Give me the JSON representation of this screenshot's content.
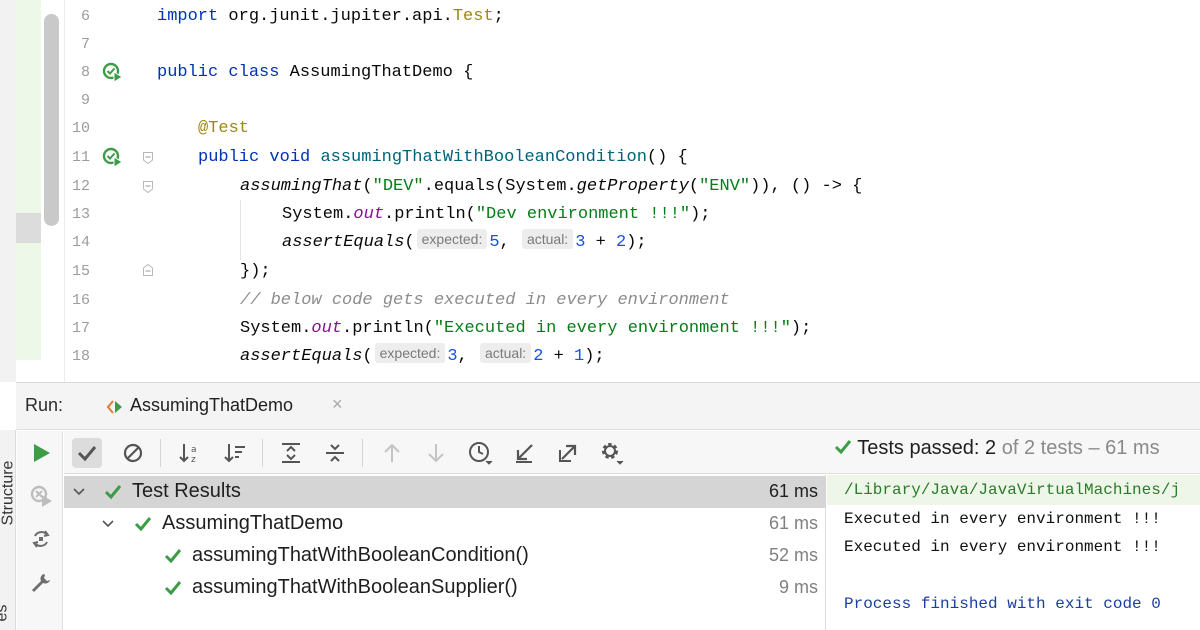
{
  "editor": {
    "lines": [
      {
        "n": "6"
      },
      {
        "n": "7"
      },
      {
        "n": "8"
      },
      {
        "n": "9"
      },
      {
        "n": "10"
      },
      {
        "n": "11"
      },
      {
        "n": "12"
      },
      {
        "n": "13"
      },
      {
        "n": "14"
      },
      {
        "n": "15"
      },
      {
        "n": "16"
      },
      {
        "n": "17"
      },
      {
        "n": "18"
      }
    ],
    "tokens": {
      "import_kw": "import",
      "import_path": " org.junit.jupiter.api.",
      "import_cls": "Test",
      "semi": ";",
      "public_kw": "public",
      "class_kw": "class",
      "class_name": " AssumingThatDemo {",
      "annotation": "@Test",
      "void_kw": "void",
      "method_name": "assumingThatWithBooleanCondition",
      "method_tail": "() {",
      "assuming_that": "assumingThat",
      "open_paren": "(",
      "dev_str": "\"DEV\"",
      "equals_sys": ".equals(System.",
      "get_property": "getProperty",
      "env_str": "\"ENV\"",
      "lambda_tail": ")), () -> {",
      "system": "System.",
      "out": "out",
      "println": ".println(",
      "dev_msg": "\"Dev environment !!!\"",
      "close_semi": ");",
      "assert_equals": "assertEquals",
      "hint_expected": "expected:",
      "hint_actual": "actual:",
      "num_5": "5",
      "num_3": "3",
      "num_2": "2",
      "num_1": "1",
      "plus": " + ",
      "comma": ", ",
      "close_lambda": "});",
      "comment": "// below code gets executed in every environment",
      "every_msg": "\"Executed in every environment !!!\""
    }
  },
  "run": {
    "label": "Run:",
    "tab_title": "AssumingThatDemo",
    "tab_close": "×",
    "side_label": "Structure",
    "side_label_2": "es",
    "status": {
      "prefix": "Tests passed: ",
      "passed": "2",
      "rest": " of 2 tests – 61 ms"
    },
    "tree": [
      {
        "label": "Test Results",
        "duration": "61 ms"
      },
      {
        "label": "AssumingThatDemo",
        "duration": "61 ms"
      },
      {
        "label": "assumingThatWithBooleanCondition()",
        "duration": "52 ms"
      },
      {
        "label": "assumingThatWithBooleanSupplier()",
        "duration": "9 ms"
      }
    ],
    "console": [
      "/Library/Java/JavaVirtualMachines/j",
      "Executed in every environment !!!",
      "Executed in every environment !!!",
      "",
      "Process finished with exit code 0"
    ]
  },
  "colors": {
    "pass_green": "#3d9c46",
    "keyword_blue": "#0033b3",
    "string_green": "#067d17",
    "number_blue": "#1750eb",
    "annotation_olive": "#9e880d"
  },
  "icons": {
    "run": "run-triangle-icon",
    "rerun_failed": "rerun-failed-icon",
    "toggle_auto_test": "auto-test-icon",
    "settings": "wrench-icon",
    "show_passed": "check-icon",
    "show_ignored": "no-entry-icon",
    "sort_alpha": "sort-alphabetically-icon",
    "sort_duration": "sort-duration-icon",
    "expand_all": "expand-all-icon",
    "collapse_all": "collapse-all-icon",
    "prev": "arrow-up-icon",
    "next": "arrow-down-icon",
    "history": "history-icon",
    "import": "import-tests-icon",
    "export": "export-tests-icon",
    "gear": "gear-icon"
  }
}
